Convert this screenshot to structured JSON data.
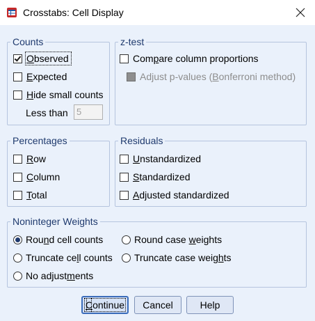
{
  "window": {
    "title": "Crosstabs: Cell Display"
  },
  "counts": {
    "legend": "Counts",
    "observed": {
      "pre": "",
      "u": "O",
      "post": "bserved",
      "checked": true
    },
    "expected": {
      "pre": "",
      "u": "E",
      "post": "xpected",
      "checked": false
    },
    "hide_small": {
      "pre": "",
      "u": "H",
      "post": "ide small counts",
      "checked": false
    },
    "less_than_label": "Less than",
    "less_than_value": "5"
  },
  "ztest": {
    "legend": "z-test",
    "compare": {
      "pre": "Com",
      "u": "p",
      "post": "are column proportions",
      "checked": false
    },
    "adjust": {
      "pre": "Adjust p-values (",
      "u": "B",
      "post": "onferroni method)",
      "checked": true,
      "disabled": true
    }
  },
  "percentages": {
    "legend": "Percentages",
    "row": {
      "pre": "",
      "u": "R",
      "post": "ow",
      "checked": false
    },
    "column": {
      "pre": "",
      "u": "C",
      "post": "olumn",
      "checked": false
    },
    "total": {
      "pre": "",
      "u": "T",
      "post": "otal",
      "checked": false
    }
  },
  "residuals": {
    "legend": "Residuals",
    "unstd": {
      "pre": "",
      "u": "U",
      "post": "nstandardized",
      "checked": false
    },
    "std": {
      "pre": "",
      "u": "S",
      "post": "tandardized",
      "checked": false
    },
    "adjstd": {
      "pre": "",
      "u": "A",
      "post": "djusted standardized",
      "checked": false
    }
  },
  "weights": {
    "legend": "Noninteger Weights",
    "round_cell": {
      "pre": "Rou",
      "u": "n",
      "post": "d cell counts",
      "selected": true
    },
    "round_case": {
      "pre": "Round case ",
      "u": "w",
      "post": "eights",
      "selected": false
    },
    "trunc_cell": {
      "pre": "Truncate ce",
      "u": "l",
      "post": "l counts",
      "selected": false
    },
    "trunc_case": {
      "pre": "Truncate case weig",
      "u": "h",
      "post": "ts",
      "selected": false
    },
    "none": {
      "pre": "No adjust",
      "u": "m",
      "post": "ents",
      "selected": false
    }
  },
  "buttons": {
    "continue": {
      "pre": "",
      "u": "C",
      "post": "ontinue"
    },
    "cancel": "Cancel",
    "help": "Help"
  },
  "colors": {
    "legend_text": "#1f3a6e",
    "dialog_bg": "#eaf1fb",
    "group_border": "#b5c4de"
  }
}
